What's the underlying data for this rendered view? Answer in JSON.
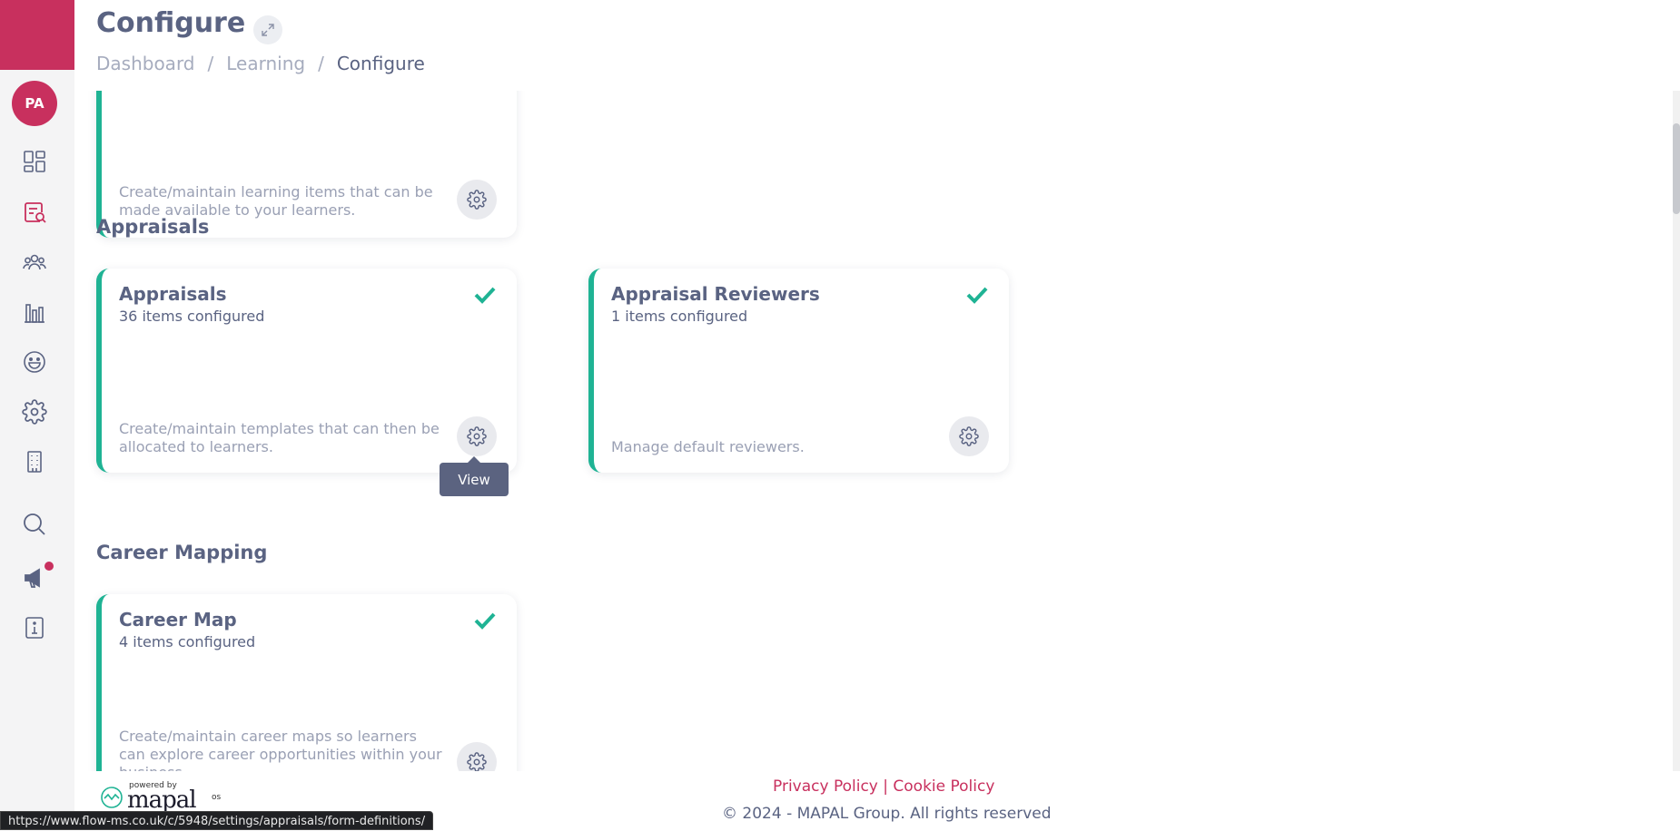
{
  "sidebar": {
    "avatar_initials": "PA",
    "items": [
      {
        "name": "dashboard-icon"
      },
      {
        "name": "learning-icon"
      },
      {
        "name": "people-icon"
      },
      {
        "name": "reports-icon"
      },
      {
        "name": "engagement-icon"
      },
      {
        "name": "settings-icon"
      },
      {
        "name": "building-icon"
      },
      {
        "name": "search-icon"
      },
      {
        "name": "announcements-icon"
      },
      {
        "name": "info-icon"
      }
    ],
    "accent_color": "#c8305e"
  },
  "header": {
    "title": "Configure",
    "breadcrumb": [
      "Dashboard",
      "/",
      "Learning",
      "/",
      "Configure"
    ]
  },
  "sections": {
    "top_card": {
      "description": "Create/maintain learning items that can be made available to your learners."
    },
    "appraisals": {
      "title": "Appraisals",
      "cards": [
        {
          "title": "Appraisals",
          "subtitle": "36 items configured",
          "description": "Create/maintain templates that can then be allocated to learners."
        },
        {
          "title": "Appraisal Reviewers",
          "subtitle": "1 items configured",
          "description": "Manage default reviewers."
        }
      ]
    },
    "career_mapping": {
      "title": "Career Mapping",
      "cards": [
        {
          "title": "Career Map",
          "subtitle": "4 items configured",
          "description": "Create/maintain career maps so learners can explore career opportunities within your business."
        }
      ]
    }
  },
  "tooltip": {
    "label": "View"
  },
  "footer": {
    "privacy": "Privacy Policy",
    "separator": "|",
    "cookie": "Cookie Policy",
    "copyright": "© 2024 - MAPAL Group. All rights reserved",
    "powered_by": "powered by",
    "brand": "mapal",
    "brand_suffix": "os"
  },
  "status_bar": {
    "url": "https://www.flow-ms.co.uk/c/5948/settings/appraisals/form-definitions/"
  },
  "colors": {
    "teal": "#1fb394",
    "text": "#5a6382",
    "muted": "#9aa0b4"
  }
}
